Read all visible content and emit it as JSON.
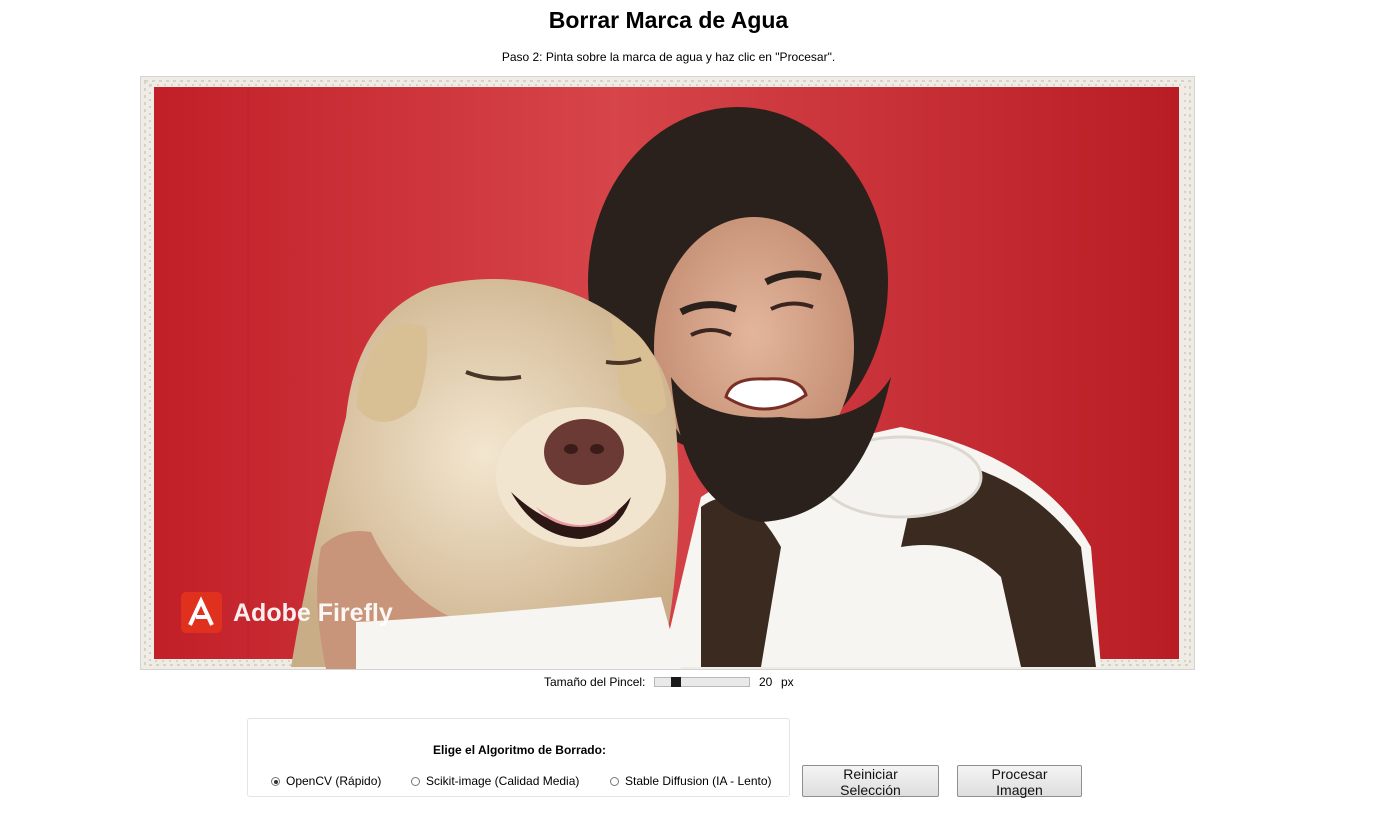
{
  "header": {
    "title": "Borrar Marca de Agua",
    "instructions": "Paso 2: Pinta sobre la marca de agua y haz clic en \"Procesar\"."
  },
  "canvas": {
    "description": "uploaded-photo-man-hugging-dog-red-background-decorative-border",
    "watermark_text": "Adobe Firefly",
    "colors": {
      "background_red": "#c8262d",
      "border_cream": "#efece6",
      "watermark_badge": "#e0301e"
    }
  },
  "brush": {
    "label": "Tamaño del Pincel:",
    "value": "20",
    "unit": "px",
    "slider_fraction": 0.19
  },
  "algorithm": {
    "title": "Elige el Algoritmo de Borrado:",
    "options": [
      {
        "label": "OpenCV (Rápido)",
        "selected": true
      },
      {
        "label": "Scikit-image (Calidad Media)",
        "selected": false
      },
      {
        "label": "Stable Diffusion (IA - Lento)",
        "selected": false
      }
    ]
  },
  "buttons": {
    "reset": "Reiniciar Selección",
    "process": "Procesar Imagen"
  }
}
